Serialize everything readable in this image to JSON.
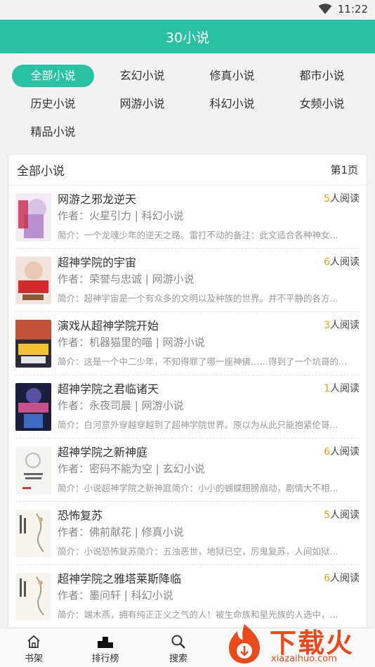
{
  "status_bar": {
    "time": "11:22"
  },
  "app_bar": {
    "title": "30小说"
  },
  "categories": [
    {
      "label": "全部小说",
      "active": true
    },
    {
      "label": "玄幻小说",
      "active": false
    },
    {
      "label": "修真小说",
      "active": false
    },
    {
      "label": "都市小说",
      "active": false
    },
    {
      "label": "历史小说",
      "active": false
    },
    {
      "label": "网游小说",
      "active": false
    },
    {
      "label": "科幻小说",
      "active": false
    },
    {
      "label": "女频小说",
      "active": false
    },
    {
      "label": "精品小说",
      "active": false
    }
  ],
  "list": {
    "heading": "全部小说",
    "page": "第1页",
    "books": [
      {
        "title": "网游之邪龙逆天",
        "readers": "5",
        "readers_suffix": "人阅读",
        "meta": "作者：火星引力 | 科幻小说",
        "intro": "简介：一个龙魂少年的逆天之路。雷打不动的备注：此文适合各种神女..."
      },
      {
        "title": "超神学院的宇宙",
        "readers": "6",
        "readers_suffix": "人阅读",
        "meta": "作者：荣誉与忠诚 | 网游小说",
        "intro": "简介：超神宇宙是一个有众多的文明以及种族的世界。并不平静的各方..."
      },
      {
        "title": "演戏从超神学院开始",
        "readers": "3",
        "readers_suffix": "人阅读",
        "meta": "作者：机器猫里的喵 | 网游小说",
        "intro": "简介：这是一个中二少年，不知得罪了哪一座神佛……得到了一个坑哥的..."
      },
      {
        "title": "超神学院之君临诸天",
        "readers": "1",
        "readers_suffix": "人阅读",
        "meta": "作者：永夜司晨 | 网游小说",
        "intro": "简介：白河意外穿越穿越到了超神学院世界。原以为从此只能抱紧伦哥..."
      },
      {
        "title": "超神学院之新神庭",
        "readers": "6",
        "readers_suffix": "人阅读",
        "meta": "作者：密码不能为空 | 玄幻小说",
        "intro": "简介：小说超神学院之新神庭简介：小小的蝴蝶翅膀扇动，剧情大不相..."
      },
      {
        "title": "恐怖复苏",
        "readers": "5",
        "readers_suffix": "人阅读",
        "meta": "作者：佛前献花 | 修真小说",
        "intro": "简介：小说恐怖复苏简介：五浊恶世，地狱已空，厉鬼复苏，人间如狱..."
      },
      {
        "title": "超神学院之雅塔莱斯降临",
        "readers": "6",
        "readers_suffix": "人阅读",
        "meta": "作者：墨问轩 | 科幻小说",
        "intro": "简介：端木燕，拥有纯正正义之气的人！被生命族和星光族的人选中，..."
      }
    ]
  },
  "bottom_nav": [
    {
      "label": "书架",
      "icon": "home-icon"
    },
    {
      "label": "排行榜",
      "icon": "podium-icon"
    },
    {
      "label": "搜索",
      "icon": "search-icon"
    }
  ],
  "watermark": {
    "brand": "下载火",
    "url": "xiazaihuo.com"
  },
  "colors": {
    "accent": "#2ac1a2",
    "reader_count": "#e8a317",
    "watermark": "#e84a1e"
  }
}
